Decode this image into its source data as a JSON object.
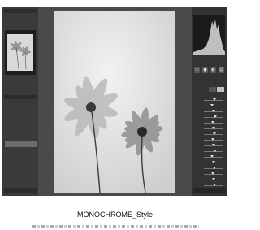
{
  "window": {
    "title": ""
  },
  "left_panel": {
    "navigator_label": "",
    "presets_label": "",
    "presets": [
      "",
      "",
      "",
      "",
      "",
      "",
      "",
      "",
      ""
    ],
    "selected_preset_index": 3
  },
  "right_panel": {
    "histogram_label": "",
    "tools": [
      "▭",
      "●",
      "◐",
      "▤"
    ],
    "sliders": [
      {
        "label": "",
        "value": 0.55
      },
      {
        "label": "",
        "value": 0.45
      },
      {
        "label": "",
        "value": 0.5
      },
      {
        "label": "",
        "value": 0.6
      },
      {
        "label": "",
        "value": 0.48
      },
      {
        "label": "",
        "value": 0.52
      },
      {
        "label": "",
        "value": 0.58
      },
      {
        "label": "",
        "value": 0.46
      },
      {
        "label": "",
        "value": 0.5
      },
      {
        "label": "",
        "value": 0.62
      },
      {
        "label": "",
        "value": 0.44
      },
      {
        "label": "",
        "value": 0.53
      },
      {
        "label": "",
        "value": 0.57
      },
      {
        "label": "",
        "value": 0.49
      },
      {
        "label": "",
        "value": 0.51
      },
      {
        "label": "",
        "value": 0.55
      }
    ]
  },
  "caption": {
    "title": "MONOCHROME_Style"
  },
  "colors": {
    "panel_bg": "#3a3a3a",
    "workspace_bg": "#4a4a4a",
    "selected_item": "#6b6b6b"
  }
}
